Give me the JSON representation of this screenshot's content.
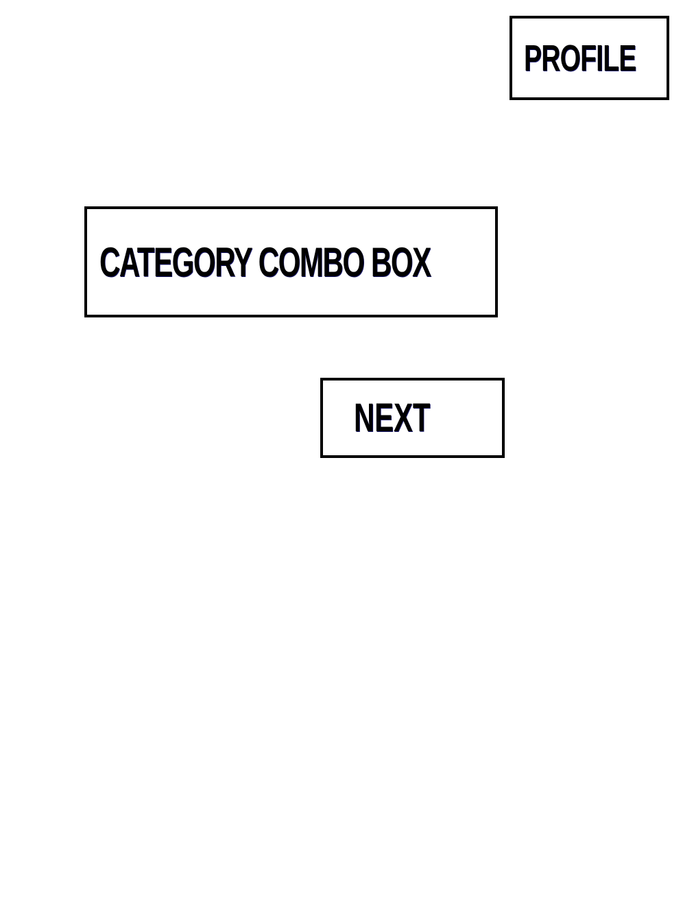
{
  "header": {
    "profile_label": "PROFILE"
  },
  "main": {
    "category_combo_label": "CATEGORY COMBO BOX",
    "next_label": "NEXT"
  },
  "colors": {
    "border": "#000000",
    "text": "#000000",
    "background": "#ffffff"
  }
}
